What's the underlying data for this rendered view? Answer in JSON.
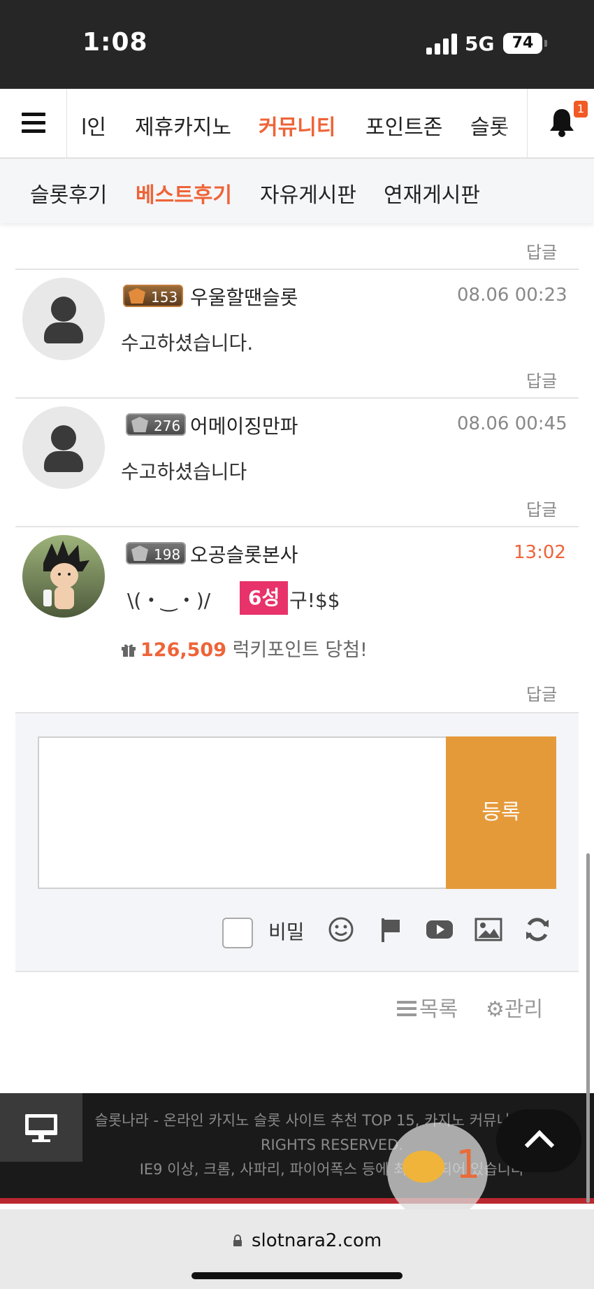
{
  "status": {
    "time": "1:08",
    "network": "5G",
    "battery": "74"
  },
  "main_nav": {
    "items": [
      "l인",
      "제휴카지노",
      "커뮤니티",
      "포인트존",
      "슬롯"
    ],
    "active": "커뮤니티",
    "notification_count": "1"
  },
  "sub_nav": {
    "items": [
      "슬롯후기",
      "베스트후기",
      "자유게시판",
      "연재게시판"
    ],
    "active": "베스트후기"
  },
  "comments": [
    {
      "level": "153",
      "username": "우울할땐슬롯",
      "time": "08.06 00:23",
      "text": "수고하셨습니다.",
      "reply": "답글"
    },
    {
      "level": "276",
      "username": "어메이징만파",
      "time": "08.06 00:45",
      "text": "수고하셨습니다",
      "reply": "답글"
    },
    {
      "level": "198",
      "username": "오공슬롯본사",
      "time": "13:02",
      "text_prefix": "\\(・‿・)/",
      "star_tag": "6성",
      "text_suffix": "구!$$",
      "luck_points": "126,509",
      "luck_text": "럭키포인트 당첨!",
      "reply": "답글"
    }
  ],
  "top_reply": "답글",
  "write": {
    "submit_label": "등록",
    "secret_label": "비밀"
  },
  "footer_links": {
    "list_label": "목록",
    "manage_label": "관리"
  },
  "site_footer": {
    "line1": "슬롯나라 - 온라인 카지노 슬롯 사이트 추천 TOP 15, 카지노 커뮤니티 ©ALL",
    "line2": "RIGHTS RESERVED.",
    "line3": "IE9 이상, 크롬, 사파리, 파이어폭스 등에 최적화 되어 있습니다"
  },
  "chat": {
    "count": "1"
  },
  "browser": {
    "url": "slotnara2.com"
  }
}
